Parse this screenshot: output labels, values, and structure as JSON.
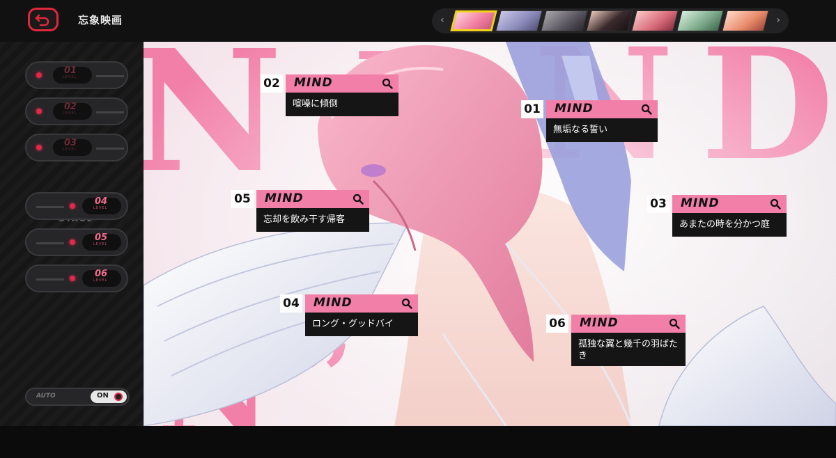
{
  "header": {
    "title": "忘象映画",
    "prev_arrow": "‹",
    "next_arrow": "›"
  },
  "characters": [
    {
      "name": "char-1",
      "active": true,
      "color": "#f0a0b8"
    },
    {
      "name": "char-2",
      "active": false,
      "color": "#8a88b8"
    },
    {
      "name": "char-3",
      "active": false,
      "color": "#6a6670"
    },
    {
      "name": "char-4",
      "active": false,
      "color": "#3a2a2e"
    },
    {
      "name": "char-5",
      "active": false,
      "color": "#d86a78"
    },
    {
      "name": "char-6",
      "active": false,
      "color": "#7aa888"
    },
    {
      "name": "char-7",
      "active": false,
      "color": "#e88a6a"
    }
  ],
  "sidebar": {
    "levels": [
      {
        "num": "01",
        "label": "LEVEL",
        "state": "locked"
      },
      {
        "num": "02",
        "label": "LEVEL",
        "state": "locked"
      },
      {
        "num": "03",
        "label": "LEVEL",
        "state": "locked"
      },
      {
        "num": "04",
        "label": "LEVEL",
        "state": "unlocked"
      },
      {
        "num": "05",
        "label": "LEVEL",
        "state": "unlocked"
      },
      {
        "num": "06",
        "label": "LEVEL",
        "state": "unlocked"
      }
    ],
    "stage_label": "STAGE",
    "auto_label": "AUTO",
    "auto_value": "ON"
  },
  "mind_cards": [
    {
      "index": "02",
      "tag": "MIND",
      "title": "喧噪に傾倒"
    },
    {
      "index": "01",
      "tag": "MIND",
      "title": "無垢なる誓い"
    },
    {
      "index": "05",
      "tag": "MIND",
      "title": "忘却を飲み干す帰客"
    },
    {
      "index": "03",
      "tag": "MIND",
      "title": "あまたの時を分かつ庭"
    },
    {
      "index": "04",
      "tag": "MIND",
      "title": "ロング・グッドバイ"
    },
    {
      "index": "06",
      "tag": "MIND",
      "title": "孤独な翼と幾千の羽ばたき"
    }
  ],
  "background_letters": [
    "N",
    "I",
    "N",
    "D",
    "N"
  ],
  "colors": {
    "accent_pink": "#f27fa8",
    "accent_red": "#e0283a",
    "active_yellow": "#f2d21b"
  }
}
